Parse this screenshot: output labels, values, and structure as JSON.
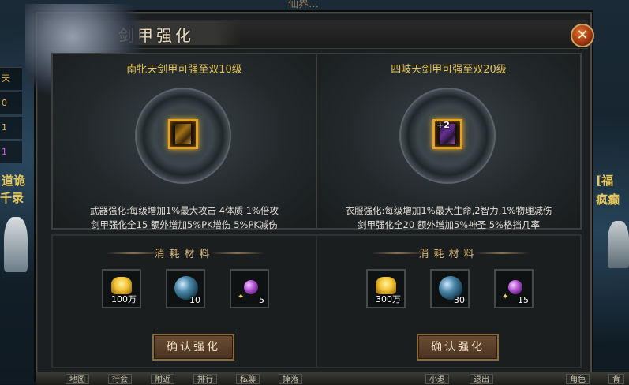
{
  "window": {
    "title": "剑甲强化",
    "close_icon": "✕"
  },
  "left_panel": {
    "title": "南牝天剑甲可强至双10级",
    "item_plus": "",
    "desc_line1": "武器强化:每级增加1%最大攻击 4体质 1%倍攻",
    "desc_line2": "剑甲强化全15 额外增加5%PK增伤 5%PK减伤",
    "materials_title": "消耗材料",
    "materials": [
      {
        "icon": "gold-ingot-icon",
        "count": "100万"
      },
      {
        "icon": "blue-orb-icon",
        "count": "10"
      },
      {
        "icon": "purple-gem-icon",
        "count": "5"
      }
    ],
    "confirm_label": "确认强化"
  },
  "right_panel": {
    "title": "四岐天剑甲可强至双20级",
    "item_plus": "+2",
    "desc_line1": "衣服强化:每级增加1%最大生命,2智力,1%物理减伤",
    "desc_line2": "剑甲强化全20 额外增加5%神圣 5%格挡几率",
    "materials_title": "消耗材料",
    "materials": [
      {
        "icon": "gold-ingot-icon",
        "count": "300万"
      },
      {
        "icon": "blue-orb-icon",
        "count": "30"
      },
      {
        "icon": "purple-gem-icon",
        "count": "15"
      }
    ],
    "confirm_label": "确认强化"
  },
  "background": {
    "left_hud": [
      "天",
      "0",
      "1",
      "1"
    ],
    "left_text_1": "道诡",
    "left_text_2": "千录",
    "right_text_1": "[福",
    "right_text_2": "疯癫",
    "top_banner": "仙界…"
  },
  "bottom_bar": {
    "buttons": [
      "地图",
      "行会",
      "附近",
      "排行",
      "私聊",
      "掉落",
      "小退",
      "退出",
      "角色",
      "背"
    ]
  }
}
